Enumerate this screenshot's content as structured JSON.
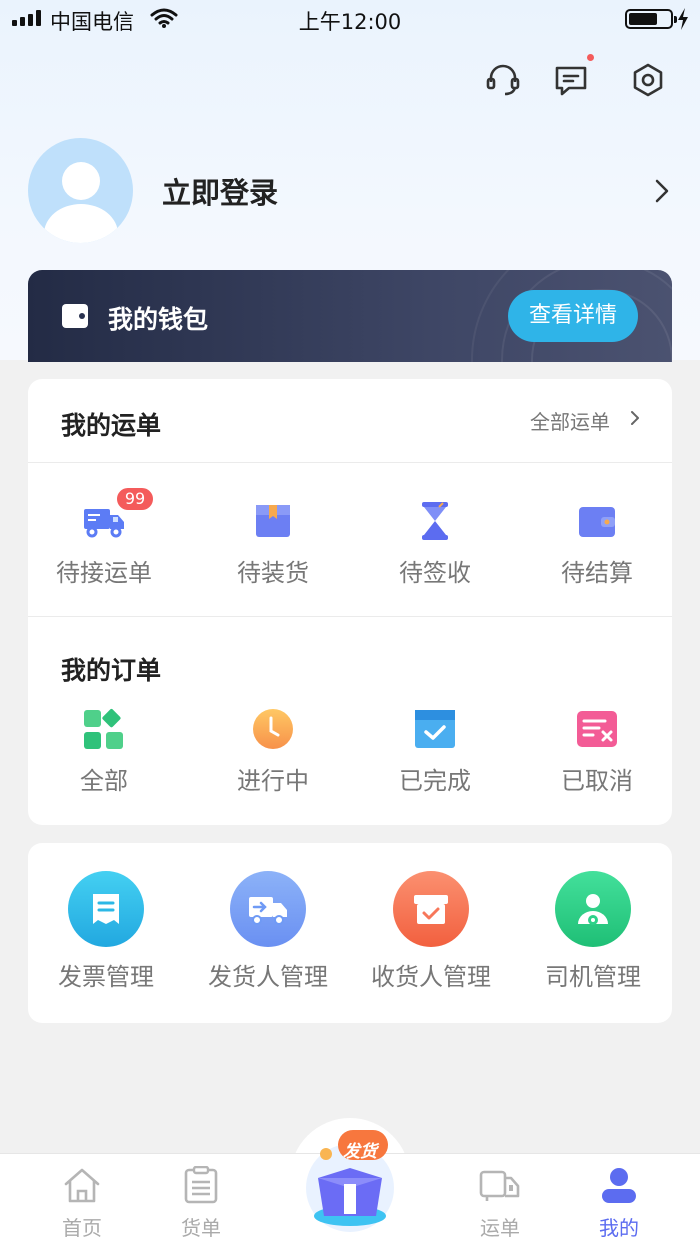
{
  "status_bar": {
    "carrier": "中国电信",
    "time": "上午12:00"
  },
  "profile": {
    "login_text": "立即登录"
  },
  "wallet": {
    "title": "我的钱包",
    "detail_button": "查看详情"
  },
  "waybills": {
    "title": "我的运单",
    "all_link": "全部运单",
    "items": [
      {
        "label": "待接运单",
        "icon": "truck-icon",
        "badge": "99"
      },
      {
        "label": "待装货",
        "icon": "package-icon"
      },
      {
        "label": "待签收",
        "icon": "hourglass-icon"
      },
      {
        "label": "待结算",
        "icon": "wallet-icon"
      }
    ]
  },
  "orders": {
    "title": "我的订单",
    "items": [
      {
        "label": "全部",
        "icon": "grid-icon"
      },
      {
        "label": "进行中",
        "icon": "clock-icon"
      },
      {
        "label": "已完成",
        "icon": "calendar-check-icon"
      },
      {
        "label": "已取消",
        "icon": "list-cancel-icon"
      }
    ]
  },
  "management": {
    "items": [
      {
        "label": "发票管理",
        "icon": "invoice-icon",
        "color": "#2cb8e6"
      },
      {
        "label": "发货人管理",
        "icon": "shipper-truck-icon",
        "color": "#6f9af5"
      },
      {
        "label": "收货人管理",
        "icon": "receiver-box-icon",
        "color": "#f7775a"
      },
      {
        "label": "司机管理",
        "icon": "driver-icon",
        "color": "#2dd289"
      }
    ]
  },
  "bottom_nav": {
    "items": [
      {
        "label": "首页",
        "icon": "home-icon"
      },
      {
        "label": "货单",
        "icon": "clipboard-icon"
      },
      {
        "label": "运单",
        "icon": "waybill-truck-icon"
      },
      {
        "label": "我的",
        "icon": "user-icon",
        "active": true
      }
    ],
    "ship_label": "发货"
  },
  "colors": {
    "accent": "#5c6cf0",
    "wallet_button": "#2fb4e8",
    "badge": "#f45b5b"
  }
}
